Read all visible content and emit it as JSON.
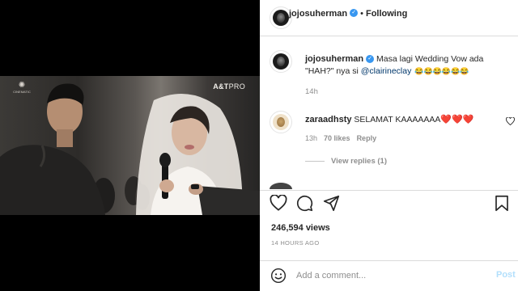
{
  "video": {
    "watermark_left": "CINEMATIC",
    "watermark_right_bold": "A&T",
    "watermark_right": "PRO"
  },
  "header": {
    "username": "jojosuherman",
    "follow_state": "Following",
    "separator": "•"
  },
  "caption": {
    "username": "jojosuherman",
    "text": "Masa lagi Wedding Vow ada \"HAH?\" nya si ",
    "mention": "@clairineclay",
    "emoji": "😂😂😂😂😂😂",
    "time": "14h"
  },
  "comment": {
    "username": "zaraadhsty",
    "text": "SELAMAT KAAAAAAA",
    "hearts": "❤️❤️❤️",
    "time": "13h",
    "likes": "70 likes",
    "reply": "Reply",
    "view_replies": "View replies (1)"
  },
  "stats": {
    "views": "246,594 views",
    "posted_ago": "14 HOURS AGO"
  },
  "comment_box": {
    "placeholder": "Add a comment...",
    "post_label": "Post"
  },
  "icons": {
    "like": "heart-outline-icon",
    "comment": "speech-bubble-icon",
    "share": "paper-plane-icon",
    "save": "bookmark-icon",
    "emoji": "smiley-icon"
  },
  "colors": {
    "verified": "#3897f0",
    "link": "#00376b",
    "post_disabled": "#b2dffc",
    "heart": "#e3203b"
  }
}
